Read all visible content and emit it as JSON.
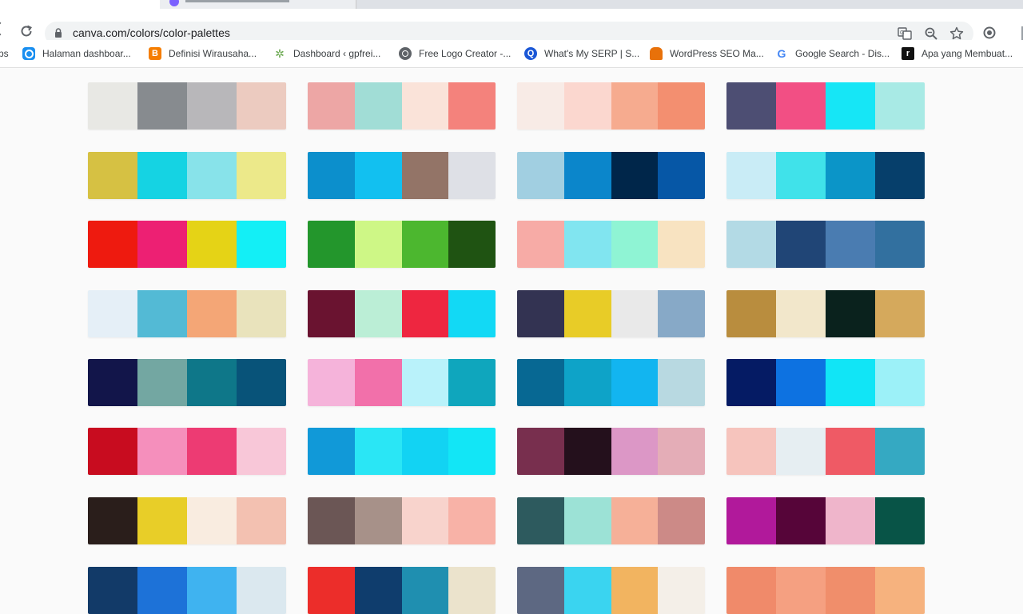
{
  "browser": {
    "url": "canva.com/colors/color-palettes",
    "bookmarks": [
      {
        "label": "ps",
        "icon": "apps-icon"
      },
      {
        "label": "Halaman dashboar...",
        "icon": "dashboard-icon",
        "color": "#1a8ff0"
      },
      {
        "label": "Definisi Wirausaha...",
        "icon": "blogger-icon",
        "color": "#f57d00"
      },
      {
        "label": "Dashboard ‹ gpfrei...",
        "icon": "leaf-icon",
        "color": "#6aa84f"
      },
      {
        "label": "Free Logo Creator -...",
        "icon": "globe-icon",
        "color": "#5f6368"
      },
      {
        "label": "What's My SERP | S...",
        "icon": "serp-icon",
        "color": "#1a57d6"
      },
      {
        "label": "WordPress SEO Ma...",
        "icon": "wordpress-seo-icon",
        "color": "#e8710a"
      },
      {
        "label": "Google Search - Dis...",
        "icon": "google-icon",
        "color": "#4285f4"
      },
      {
        "label": "Apa yang Membuat...",
        "icon": "r-icon",
        "color": "#111111"
      }
    ]
  },
  "palettes": [
    [
      "#e8e8e4",
      "#878b8f",
      "#b8b7ba",
      "#eccbc0"
    ],
    [
      "#eda6a5",
      "#a1ddd6",
      "#fae3d9",
      "#f4827c"
    ],
    [
      "#f8ebe6",
      "#fbd7cf",
      "#f6ab8f",
      "#f38f70"
    ],
    [
      "#4d4e73",
      "#f24f84",
      "#16e6f6",
      "#a8eae5"
    ],
    [
      "#d6c143",
      "#15d3e3",
      "#88e3ea",
      "#ece98a"
    ],
    [
      "#0c8fcc",
      "#12c0f0",
      "#937467",
      "#dee0e6"
    ],
    [
      "#a1cfe1",
      "#0b86cb",
      "#00264a",
      "#0657a6"
    ],
    [
      "#c9ecf6",
      "#40e2ea",
      "#0b95c8",
      "#063f6b"
    ],
    [
      "#ee1a0f",
      "#ed2073",
      "#e5d316",
      "#13eff6"
    ],
    [
      "#23962c",
      "#cef786",
      "#4cb72f",
      "#1f5312"
    ],
    [
      "#f7aba6",
      "#81e5f0",
      "#8ff4d4",
      "#f8e3c1"
    ],
    [
      "#b3dae5",
      "#204576",
      "#4a7cb1",
      "#32709f"
    ],
    [
      "#e5eff7",
      "#53bad5",
      "#f4a676",
      "#e9e3bc"
    ],
    [
      "#6a1330",
      "#bbeed6",
      "#ee2640",
      "#12d9f5"
    ],
    [
      "#333352",
      "#e8cc27",
      "#e9e9e9",
      "#87a9c7"
    ],
    [
      "#b98d3e",
      "#f2e7cb",
      "#0a221d",
      "#d5a95c"
    ],
    [
      "#12154a",
      "#73a7a2",
      "#0e7789",
      "#085379"
    ],
    [
      "#f5b3da",
      "#f270aa",
      "#b9f2fa",
      "#0fa6bd"
    ],
    [
      "#076893",
      "#0ea3c8",
      "#12b5f0",
      "#b8d9e1"
    ],
    [
      "#051b64",
      "#0d72e1",
      "#11e5f6",
      "#9cf1f8"
    ],
    [
      "#c80c1f",
      "#f58fbc",
      "#ed3b73",
      "#f8c7d8"
    ],
    [
      "#1199d8",
      "#2ae6f5",
      "#12d3f3",
      "#12e6f6"
    ],
    [
      "#782f4e",
      "#24101c",
      "#dc97c6",
      "#e4adb7"
    ],
    [
      "#f6c4bd",
      "#e6eef2",
      "#ef5a65",
      "#35a9c2"
    ],
    [
      "#2a1e1b",
      "#e8ce28",
      "#f9ece0",
      "#f3c1b1"
    ],
    [
      "#6b5655",
      "#a79189",
      "#f8d3cc",
      "#f8b2a7"
    ],
    [
      "#2d5a5e",
      "#9ce2d6",
      "#f6b098",
      "#cc8a87"
    ],
    [
      "#b1199b",
      "#560539",
      "#efb5cb",
      "#085447"
    ],
    [
      "#123a68",
      "#1d72d8",
      "#3fb3f0",
      "#dbe8ef"
    ],
    [
      "#ec2d2a",
      "#0f3d6d",
      "#1f8fb0",
      "#ebe3cc"
    ],
    [
      "#5d6882",
      "#3ad4f0",
      "#f2b460",
      "#f4efe8"
    ],
    [
      "#f08a6a",
      "#f5a081",
      "#f08e6b",
      "#f6b27e"
    ]
  ]
}
